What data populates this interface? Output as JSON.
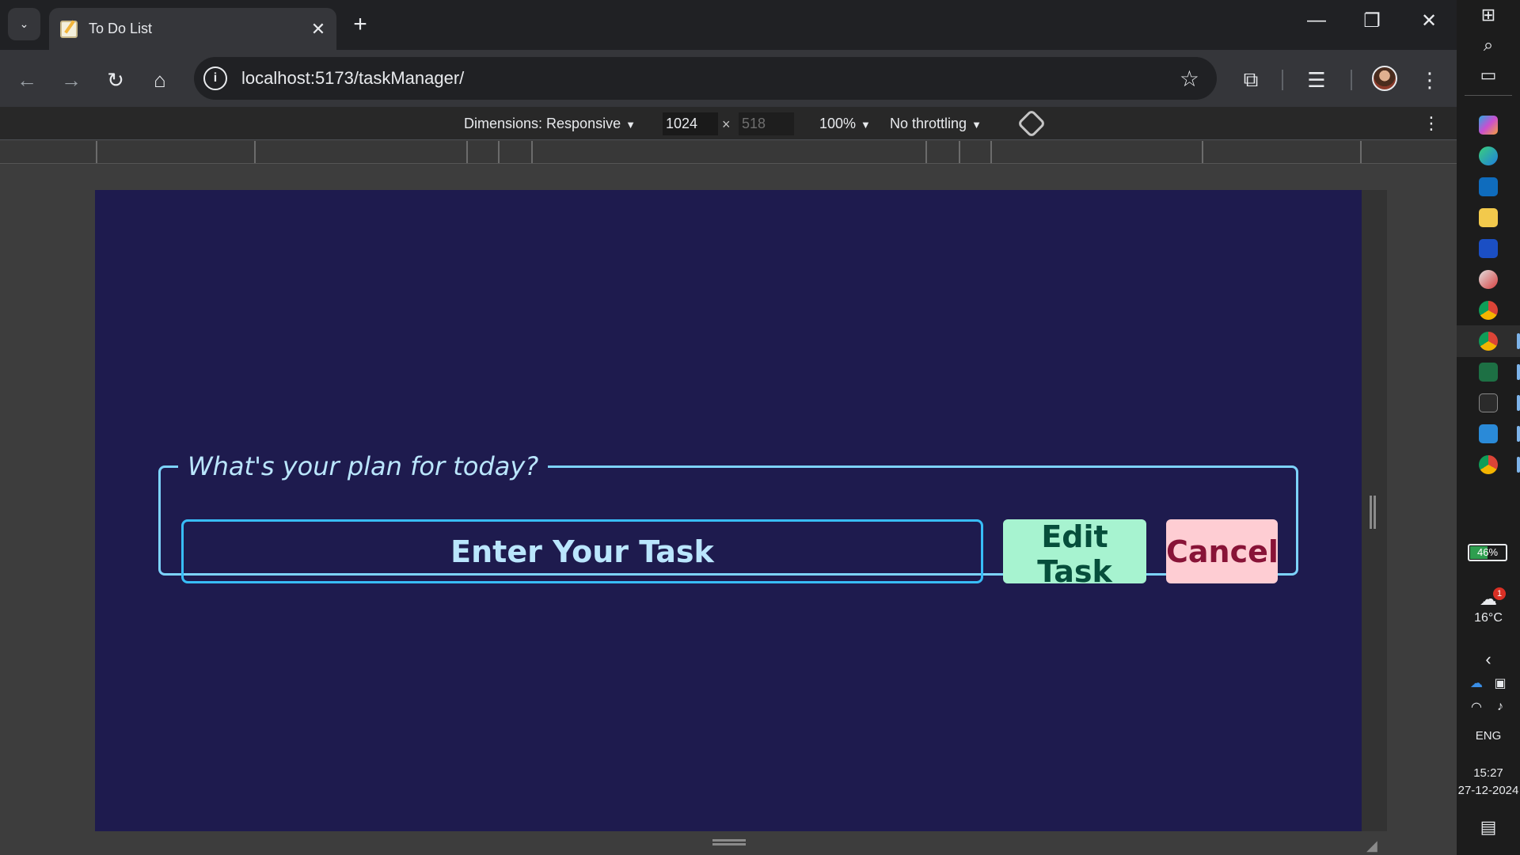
{
  "tab": {
    "title": "To Do List",
    "close_glyph": "✕",
    "new_tab_glyph": "+"
  },
  "window_controls": {
    "minimize": "—",
    "restore": "❐",
    "close": "✕"
  },
  "address_bar": {
    "url": "localhost:5173/taskManager/"
  },
  "device_toolbar": {
    "dimensions_label": "Dimensions: Responsive",
    "width": "1024",
    "height": "518",
    "zoom": "100%",
    "throttling": "No throttling"
  },
  "app": {
    "legend": "What's your plan for today?",
    "input_placeholder": "Enter Your Task",
    "edit_button": "Edit Task",
    "cancel_button": "Cancel"
  },
  "taskbar": {
    "battery": "46%",
    "weather_temp": "16°C",
    "weather_badge": "1",
    "language": "ENG",
    "time": "15:27",
    "date": "27-12-2024"
  },
  "colors": {
    "page_bg": "#1e1b4e",
    "fieldset_border": "#7dd3fc",
    "input_border": "#38bdf8",
    "edit_bg": "#a7f3d0",
    "cancel_bg": "#fecdd3"
  }
}
